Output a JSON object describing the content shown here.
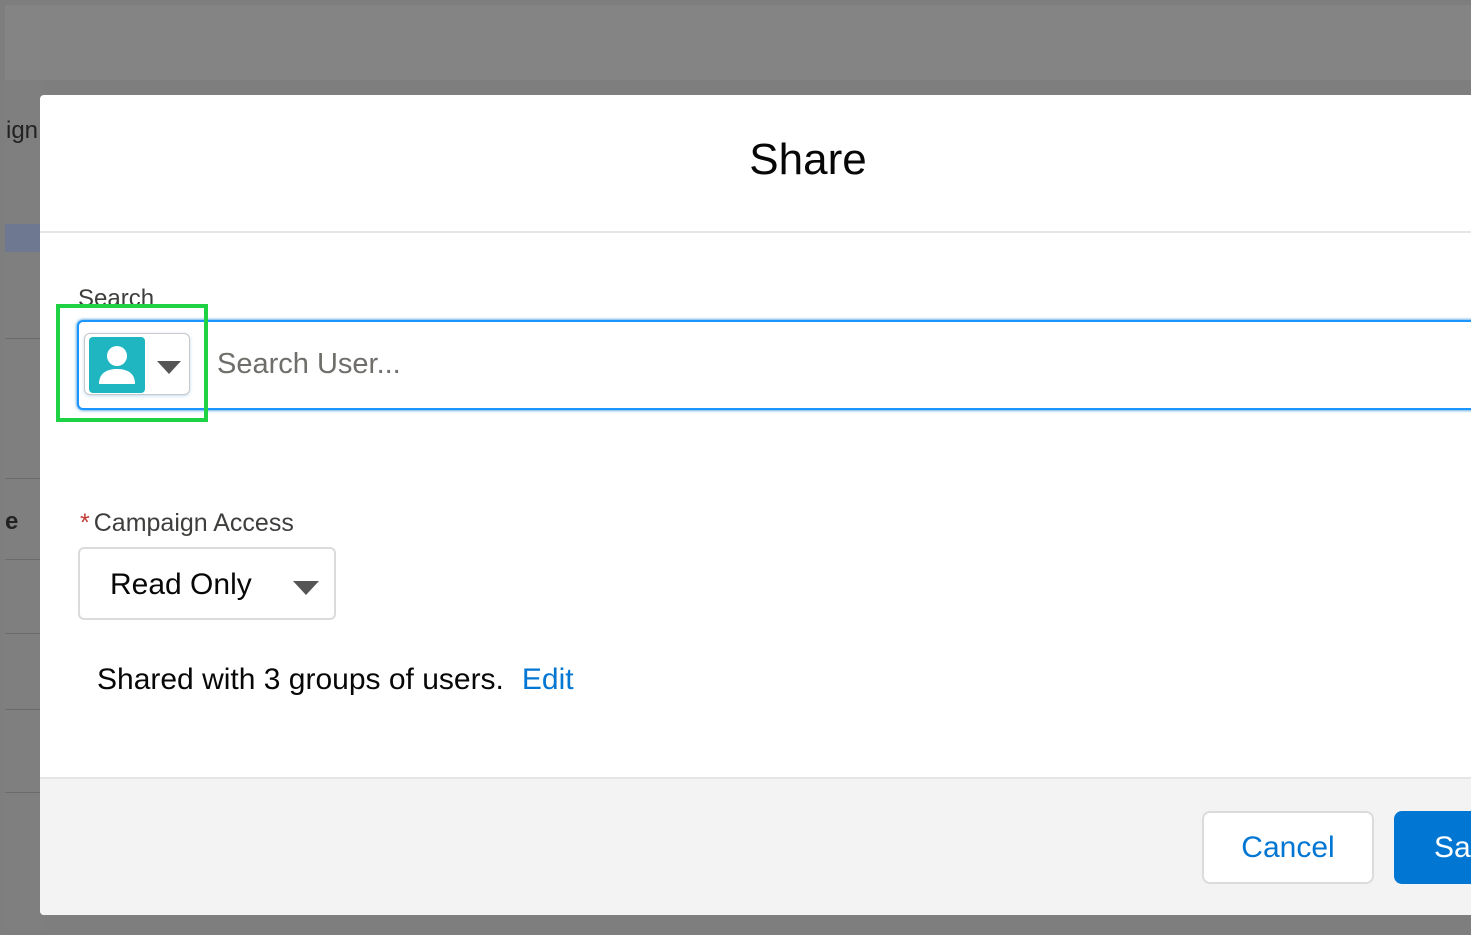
{
  "background": {
    "partial_texts": [
      "ign",
      "e"
    ]
  },
  "modal": {
    "title": "Share",
    "search": {
      "label": "Search",
      "placeholder": "Search User...",
      "entity_type_icon": "user-icon"
    },
    "campaign_access": {
      "required_marker": "*",
      "label": "Campaign Access",
      "selected_value": "Read Only"
    },
    "shared": {
      "text": "Shared with 3 groups of users.",
      "edit_link": "Edit"
    },
    "footer": {
      "cancel_label": "Cancel",
      "save_label": "Save"
    }
  },
  "highlight_color": "#1fd244",
  "accent_color": "#0176d3"
}
